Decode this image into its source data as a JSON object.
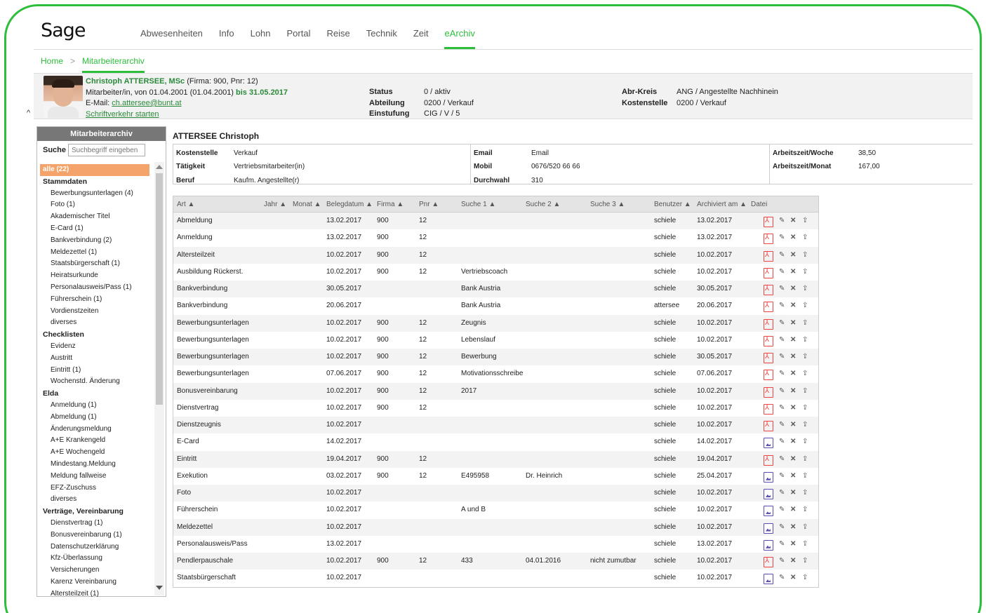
{
  "logo": "Sage",
  "topnav": [
    "Abwesenheiten",
    "Info",
    "Lohn",
    "Portal",
    "Reise",
    "Technik",
    "Zeit",
    "eArchiv"
  ],
  "topnav_active": "eArchiv",
  "breadcrumb": {
    "home": "Home",
    "sep": ">",
    "current": "Mitarbeiterarchiv"
  },
  "employee": {
    "name": "Christoph ATTERSEE, MSc",
    "name_suffix": " (Firma: 900, Pnr: 12)",
    "employment": "Mitarbeiter/in, von 01.04.2001 (01.04.2001) ",
    "employment_end": "bis 31.05.2017",
    "email_label": "E-Mail: ",
    "email": "ch.attersee@bunt.at",
    "link": "Schriftverkehr starten",
    "collapse": "^",
    "status_k": "Status",
    "status_v": "0 / aktiv",
    "abteilung_k": "Abteilung",
    "abteilung_v": "0200 / Verkauf",
    "einstufung_k": "Einstufung",
    "einstufung_v": "CIG / V / 5",
    "abrkreis_k": "Abr-Kreis",
    "abrkreis_v": "ANG / Angestellte Nachhinein",
    "kostenstelle_k": "Kostenstelle",
    "kostenstelle_v": "0200 / Verkauf"
  },
  "sidebar": {
    "title": "Mitarbeiterarchiv",
    "search_label": "Suche",
    "search_placeholder": "Suchbegriff eingeben",
    "items": [
      {
        "t": "all",
        "label": "alle (22)"
      },
      {
        "t": "grp",
        "label": "Stammdaten"
      },
      {
        "t": "sub",
        "label": "Bewerbungsunterlagen (4)"
      },
      {
        "t": "sub",
        "label": "Foto (1)"
      },
      {
        "t": "sub",
        "label": "Akademischer Titel"
      },
      {
        "t": "sub",
        "label": "E-Card (1)"
      },
      {
        "t": "sub",
        "label": "Bankverbindung (2)"
      },
      {
        "t": "sub",
        "label": "Meldezettel (1)"
      },
      {
        "t": "sub",
        "label": "Staatsbürgerschaft (1)"
      },
      {
        "t": "sub",
        "label": "Heiratsurkunde"
      },
      {
        "t": "sub",
        "label": "Personalausweis/Pass (1)"
      },
      {
        "t": "sub",
        "label": "Führerschein (1)"
      },
      {
        "t": "sub",
        "label": "Vordienstzeiten"
      },
      {
        "t": "sub",
        "label": "diverses"
      },
      {
        "t": "grp",
        "label": "Checklisten"
      },
      {
        "t": "sub",
        "label": "Evidenz"
      },
      {
        "t": "sub",
        "label": "Austritt"
      },
      {
        "t": "sub",
        "label": "Eintritt (1)"
      },
      {
        "t": "sub",
        "label": "Wochenstd. Änderung"
      },
      {
        "t": "grp",
        "label": "Elda"
      },
      {
        "t": "sub",
        "label": "Anmeldung (1)"
      },
      {
        "t": "sub",
        "label": "Abmeldung (1)"
      },
      {
        "t": "sub",
        "label": "Änderungsmeldung"
      },
      {
        "t": "sub",
        "label": "A+E Krankengeld"
      },
      {
        "t": "sub",
        "label": "A+E Wochengeld"
      },
      {
        "t": "sub",
        "label": "Mindestang.Meldung"
      },
      {
        "t": "sub",
        "label": "Meldung fallweise"
      },
      {
        "t": "sub",
        "label": "EFZ-Zuschuss"
      },
      {
        "t": "sub",
        "label": "diverses"
      },
      {
        "t": "grp",
        "label": "Verträge, Vereinbarung"
      },
      {
        "t": "sub",
        "label": "Dienstvertrag (1)"
      },
      {
        "t": "sub",
        "label": "Bonusvereinbarung (1)"
      },
      {
        "t": "sub",
        "label": "Datenschutzerklärung"
      },
      {
        "t": "sub",
        "label": "Kfz-Überlassung"
      },
      {
        "t": "sub",
        "label": "Versicherungen"
      },
      {
        "t": "sub",
        "label": "Karenz Vereinbarung"
      },
      {
        "t": "sub",
        "label": "Altersteilzeit (1)"
      }
    ]
  },
  "details": {
    "title": "ATTERSEE Christoph",
    "col1": [
      [
        "Kostenstelle",
        "Verkauf"
      ],
      [
        "Tätigkeit",
        "Vertriebsmitarbeiter(in)"
      ],
      [
        "Beruf",
        "Kaufm. Angestellte(r)"
      ]
    ],
    "col2": [
      [
        "Email",
        "Email"
      ],
      [
        "Mobil",
        "0676/520 66 66"
      ],
      [
        "Durchwahl",
        "310"
      ]
    ],
    "col3": [
      [
        "Arbeitszeit/Woche",
        "38,50"
      ],
      [
        "Arbeitszeit/Monat",
        "167,00"
      ]
    ]
  },
  "table": {
    "headers": [
      "Art ▲",
      "Jahr ▲",
      "Monat ▲",
      "Belegdatum ▲",
      "Firma ▲",
      "Pnr ▲",
      "Suche 1 ▲",
      "Suche 2 ▲",
      "Suche 3 ▲",
      "Benutzer ▲",
      "Archiviert am ▲",
      "Datei"
    ],
    "actions": [
      "✎",
      "✕",
      "⇪"
    ],
    "rows": [
      [
        "Abmeldung",
        "",
        "",
        "13.02.2017",
        "900",
        "12",
        "",
        "",
        "",
        "schiele",
        "13.02.2017",
        "pdf"
      ],
      [
        "Anmeldung",
        "",
        "",
        "13.02.2017",
        "900",
        "12",
        "",
        "",
        "",
        "schiele",
        "13.02.2017",
        "pdf"
      ],
      [
        "Altersteilzeit",
        "",
        "",
        "10.02.2017",
        "900",
        "12",
        "",
        "",
        "",
        "schiele",
        "10.02.2017",
        "pdf"
      ],
      [
        "Ausbildung Rückerst.",
        "",
        "",
        "10.02.2017",
        "900",
        "12",
        "Vertriebscoach",
        "",
        "",
        "schiele",
        "10.02.2017",
        "pdf"
      ],
      [
        "Bankverbindung",
        "",
        "",
        "30.05.2017",
        "",
        "",
        "Bank Austria",
        "",
        "",
        "schiele",
        "30.05.2017",
        "pdf"
      ],
      [
        "Bankverbindung",
        "",
        "",
        "20.06.2017",
        "",
        "",
        "Bank Austria",
        "",
        "",
        "attersee",
        "20.06.2017",
        "pdf"
      ],
      [
        "Bewerbungsunterlagen",
        "",
        "",
        "10.02.2017",
        "900",
        "12",
        "Zeugnis",
        "",
        "",
        "schiele",
        "10.02.2017",
        "pdf"
      ],
      [
        "Bewerbungsunterlagen",
        "",
        "",
        "10.02.2017",
        "900",
        "12",
        "Lebenslauf",
        "",
        "",
        "schiele",
        "10.02.2017",
        "pdf"
      ],
      [
        "Bewerbungsunterlagen",
        "",
        "",
        "10.02.2017",
        "900",
        "12",
        "Bewerbung",
        "",
        "",
        "schiele",
        "30.05.2017",
        "pdf"
      ],
      [
        "Bewerbungsunterlagen",
        "",
        "",
        "07.06.2017",
        "900",
        "12",
        "Motivationsschreibe",
        "",
        "",
        "schiele",
        "07.06.2017",
        "pdf"
      ],
      [
        "Bonusvereinbarung",
        "",
        "",
        "10.02.2017",
        "900",
        "12",
        "2017",
        "",
        "",
        "schiele",
        "10.02.2017",
        "pdf"
      ],
      [
        "Dienstvertrag",
        "",
        "",
        "10.02.2017",
        "900",
        "12",
        "",
        "",
        "",
        "schiele",
        "10.02.2017",
        "pdf"
      ],
      [
        "Dienstzeugnis",
        "",
        "",
        "10.02.2017",
        "",
        "",
        "",
        "",
        "",
        "schiele",
        "10.02.2017",
        "pdf"
      ],
      [
        "E-Card",
        "",
        "",
        "14.02.2017",
        "",
        "",
        "",
        "",
        "",
        "schiele",
        "14.02.2017",
        "img"
      ],
      [
        "Eintritt",
        "",
        "",
        "19.04.2017",
        "900",
        "12",
        "",
        "",
        "",
        "schiele",
        "19.04.2017",
        "pdf"
      ],
      [
        "Exekution",
        "",
        "",
        "03.02.2017",
        "900",
        "12",
        "E495958",
        "Dr. Heinrich",
        "",
        "schiele",
        "25.04.2017",
        "img"
      ],
      [
        "Foto",
        "",
        "",
        "10.02.2017",
        "",
        "",
        "",
        "",
        "",
        "schiele",
        "10.02.2017",
        "img"
      ],
      [
        "Führerschein",
        "",
        "",
        "10.02.2017",
        "",
        "",
        "A und B",
        "",
        "",
        "schiele",
        "10.02.2017",
        "img"
      ],
      [
        "Meldezettel",
        "",
        "",
        "10.02.2017",
        "",
        "",
        "",
        "",
        "",
        "schiele",
        "10.02.2017",
        "img"
      ],
      [
        "Personalausweis/Pass",
        "",
        "",
        "13.02.2017",
        "",
        "",
        "",
        "",
        "",
        "schiele",
        "13.02.2017",
        "img"
      ],
      [
        "Pendlerpauschale",
        "",
        "",
        "10.02.2017",
        "900",
        "12",
        "433",
        "04.01.2016",
        "nicht zumutbar",
        "schiele",
        "10.02.2017",
        "pdf"
      ],
      [
        "Staatsbürgerschaft",
        "",
        "",
        "10.02.2017",
        "",
        "",
        "",
        "",
        "",
        "schiele",
        "10.02.2017",
        "img"
      ]
    ]
  }
}
